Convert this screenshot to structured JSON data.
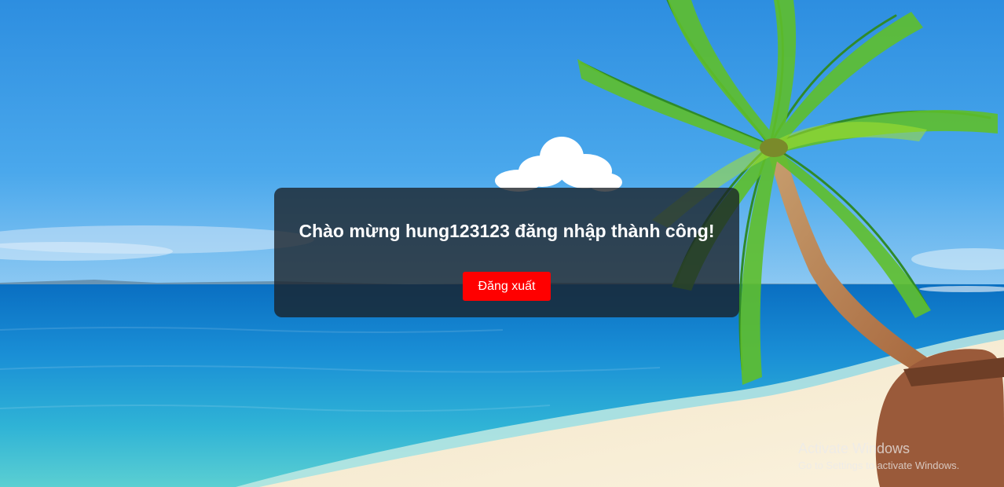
{
  "welcome": {
    "message": "Chào mừng hung123123 đăng nhập thành công!",
    "logout_label": "Đăng xuất"
  },
  "watermark": {
    "title": "Activate Windows",
    "subtitle": "Go to Settings to activate Windows."
  },
  "colors": {
    "logout_button": "#ff0000",
    "card_background": "rgba(26,32,38,0.78)",
    "text": "#ffffff"
  }
}
